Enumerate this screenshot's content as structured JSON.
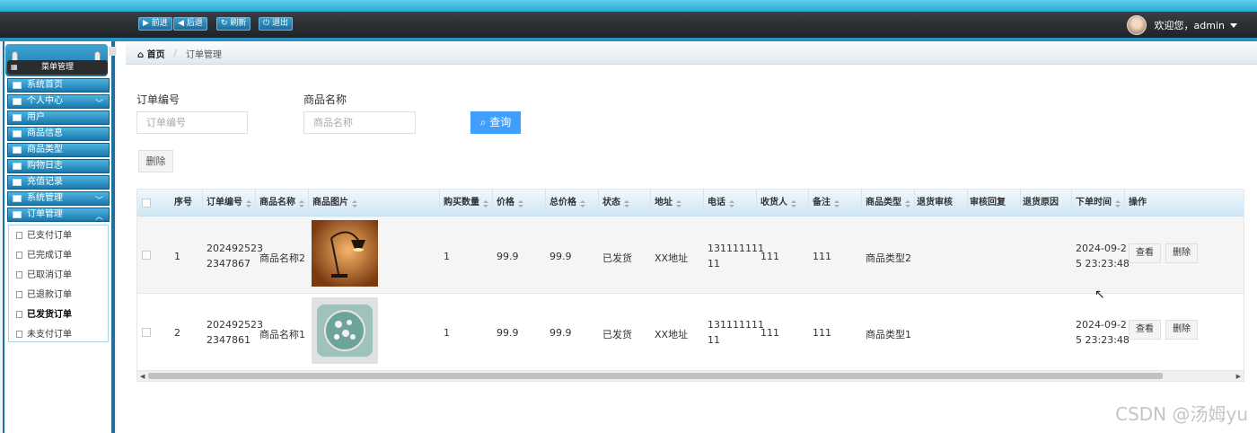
{
  "topnav": {
    "forward": "前进",
    "back": "后退",
    "refresh": "刷新",
    "exit": "退出",
    "welcome": "欢迎您，admin"
  },
  "sidebar": {
    "title": "菜单管理",
    "items": [
      {
        "label": "系统首页",
        "expandable": false
      },
      {
        "label": "个人中心",
        "expandable": true
      },
      {
        "label": "用户",
        "expandable": false
      },
      {
        "label": "商品信息",
        "expandable": false
      },
      {
        "label": "商品类型",
        "expandable": false
      },
      {
        "label": "购物日志",
        "expandable": false
      },
      {
        "label": "充值记录",
        "expandable": false
      },
      {
        "label": "系统管理",
        "expandable": true
      },
      {
        "label": "订单管理",
        "expandable": true,
        "expanded": true
      }
    ],
    "subitems": [
      "已支付订单",
      "已完成订单",
      "已取消订单",
      "已退款订单",
      "已发货订单",
      "未支付订单"
    ],
    "active_subitem": "已发货订单"
  },
  "breadcrumb": {
    "home": "首页",
    "current": "订单管理"
  },
  "search": {
    "order_no_label": "订单编号",
    "order_no_placeholder": "订单编号",
    "product_label": "商品名称",
    "product_placeholder": "商品名称",
    "query_button": "查询"
  },
  "actions": {
    "delete": "删除"
  },
  "table": {
    "headers": [
      "序号",
      "订单编号",
      "商品名称",
      "商品图片",
      "购买数量",
      "价格",
      "总价格",
      "状态",
      "地址",
      "电话",
      "收货人",
      "备注",
      "商品类型",
      "退货审核",
      "审核回复",
      "退货原因",
      "下单时间",
      "操作"
    ],
    "rows": [
      {
        "index": "1",
        "order_no_a": "202492523",
        "order_no_b": "2347867",
        "product_name": "商品名称2",
        "image": "lamp",
        "quantity": "1",
        "price": "99.9",
        "total": "99.9",
        "status": "已发货",
        "address": "XX地址",
        "phone_a": "131111111",
        "phone_b": "11",
        "receiver": "111",
        "remark": "111",
        "type": "商品类型2",
        "time_a": "2024-09-2",
        "time_b": "5 23:23:48",
        "view": "查看",
        "del": "删除"
      },
      {
        "index": "2",
        "order_no_a": "202492523",
        "order_no_b": "2347861",
        "product_name": "商品名称1",
        "image": "pillow",
        "quantity": "1",
        "price": "99.9",
        "total": "99.9",
        "status": "已发货",
        "address": "XX地址",
        "phone_a": "131111111",
        "phone_b": "11",
        "receiver": "111",
        "remark": "111",
        "type": "商品类型1",
        "time_a": "2024-09-2",
        "time_b": "5 23:23:48",
        "view": "查看",
        "del": "删除"
      }
    ]
  },
  "watermark": "CSDN @汤姆yu",
  "colors": {
    "accent": "#409eff",
    "topbar": "#26292e",
    "menu_blue": "#2a8fc4"
  }
}
